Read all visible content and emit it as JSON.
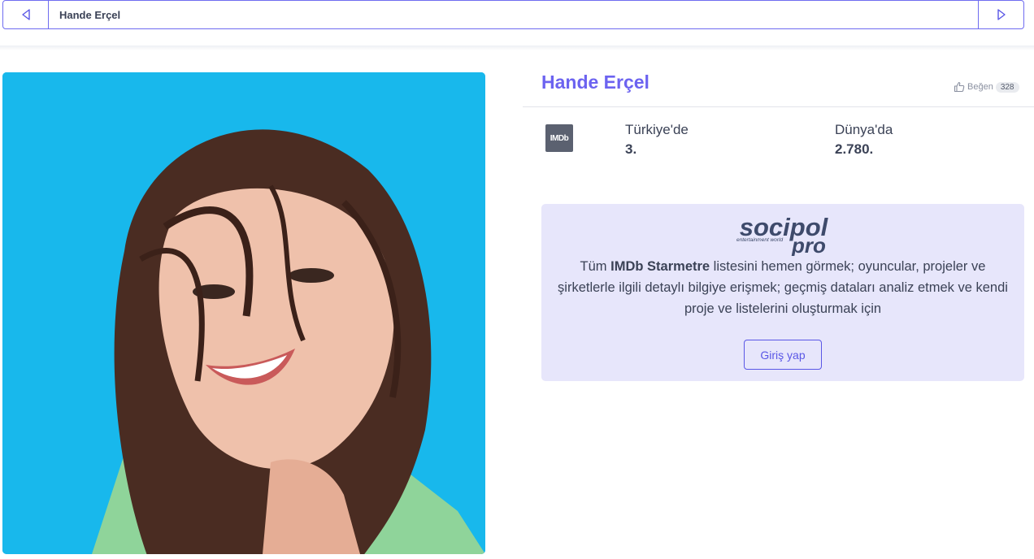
{
  "nav": {
    "title": "Hande Erçel",
    "prev_icon": "triangle-left-icon",
    "next_icon": "triangle-right-icon"
  },
  "profile": {
    "name": "Hande Erçel",
    "like_label": "Beğen",
    "like_count": "328",
    "photo_alt": "Hande Erçel"
  },
  "imdb": {
    "logo_text": "IMDb",
    "turkey_label": "Türkiye'de",
    "turkey_value": "3.",
    "world_label": "Dünya'da",
    "world_value": "2.780."
  },
  "promo": {
    "logo_main": "socipol",
    "logo_sub": "pro",
    "logo_tagline": "entertainment world",
    "text_before": "Tüm ",
    "text_bold": "IMDb Starmetre",
    "text_after": " listesini hemen görmek; oyuncular, projeler ve şirketlerle ilgili detaylı bilgiye erişmek; geçmiş dataları analiz etmek ve kendi proje ve listelerini oluşturmak için",
    "login_label": "Giriş yap"
  },
  "colors": {
    "accent": "#6c63f0",
    "photo_bg": "#18b8ec",
    "promo_bg": "#e7e6fb",
    "logo": "#3e4a6b"
  }
}
